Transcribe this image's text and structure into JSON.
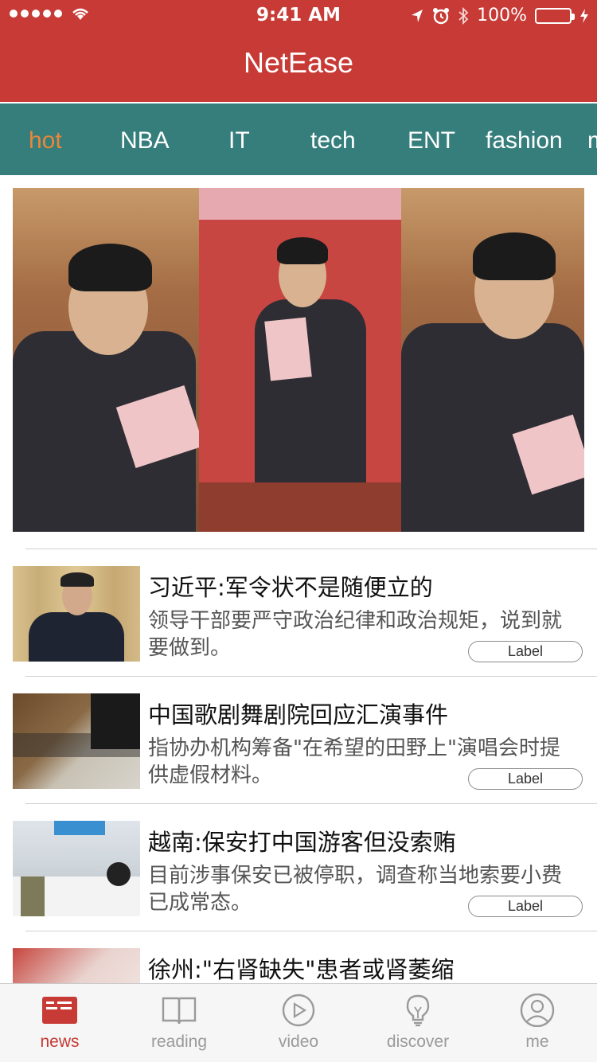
{
  "status_bar": {
    "time": "9:41 AM",
    "battery_percent": "100%",
    "battery_level": 1.0
  },
  "header": {
    "title": "NetEase",
    "color": "#c73a35"
  },
  "category_tabs": {
    "color": "#357e7c",
    "active_color": "#e8873a",
    "items": [
      {
        "label": "hot"
      },
      {
        "label": "NBA"
      },
      {
        "label": "IT"
      },
      {
        "label": "tech"
      },
      {
        "label": "ENT"
      },
      {
        "label": "fashion"
      },
      {
        "label": "m"
      }
    ]
  },
  "news": [
    {
      "headline": "习近平:军令状不是随便立的",
      "summary": "领导干部要严守政治纪律和政治规矩，说到就要做到。",
      "label": "Label"
    },
    {
      "headline": "中国歌剧舞剧院回应汇演事件",
      "summary": "指协办机构筹备\"在希望的田野上\"演唱会时提供虚假材料。",
      "label": "Label"
    },
    {
      "headline": "越南:保安打中国游客但没索贿",
      "summary": "目前涉事保安已被停职，调查称当地索要小费已成常态。",
      "label": "Label"
    },
    {
      "headline": "徐州:\"右肾缺失\"患者或肾萎缩"
    }
  ],
  "tab_bar": {
    "active_color": "#c73a35",
    "items": [
      {
        "label": "news",
        "icon": "newspaper-icon"
      },
      {
        "label": "reading",
        "icon": "book-icon"
      },
      {
        "label": "video",
        "icon": "play-icon"
      },
      {
        "label": "discover",
        "icon": "lightbulb-icon"
      },
      {
        "label": "me",
        "icon": "user-icon"
      }
    ]
  }
}
